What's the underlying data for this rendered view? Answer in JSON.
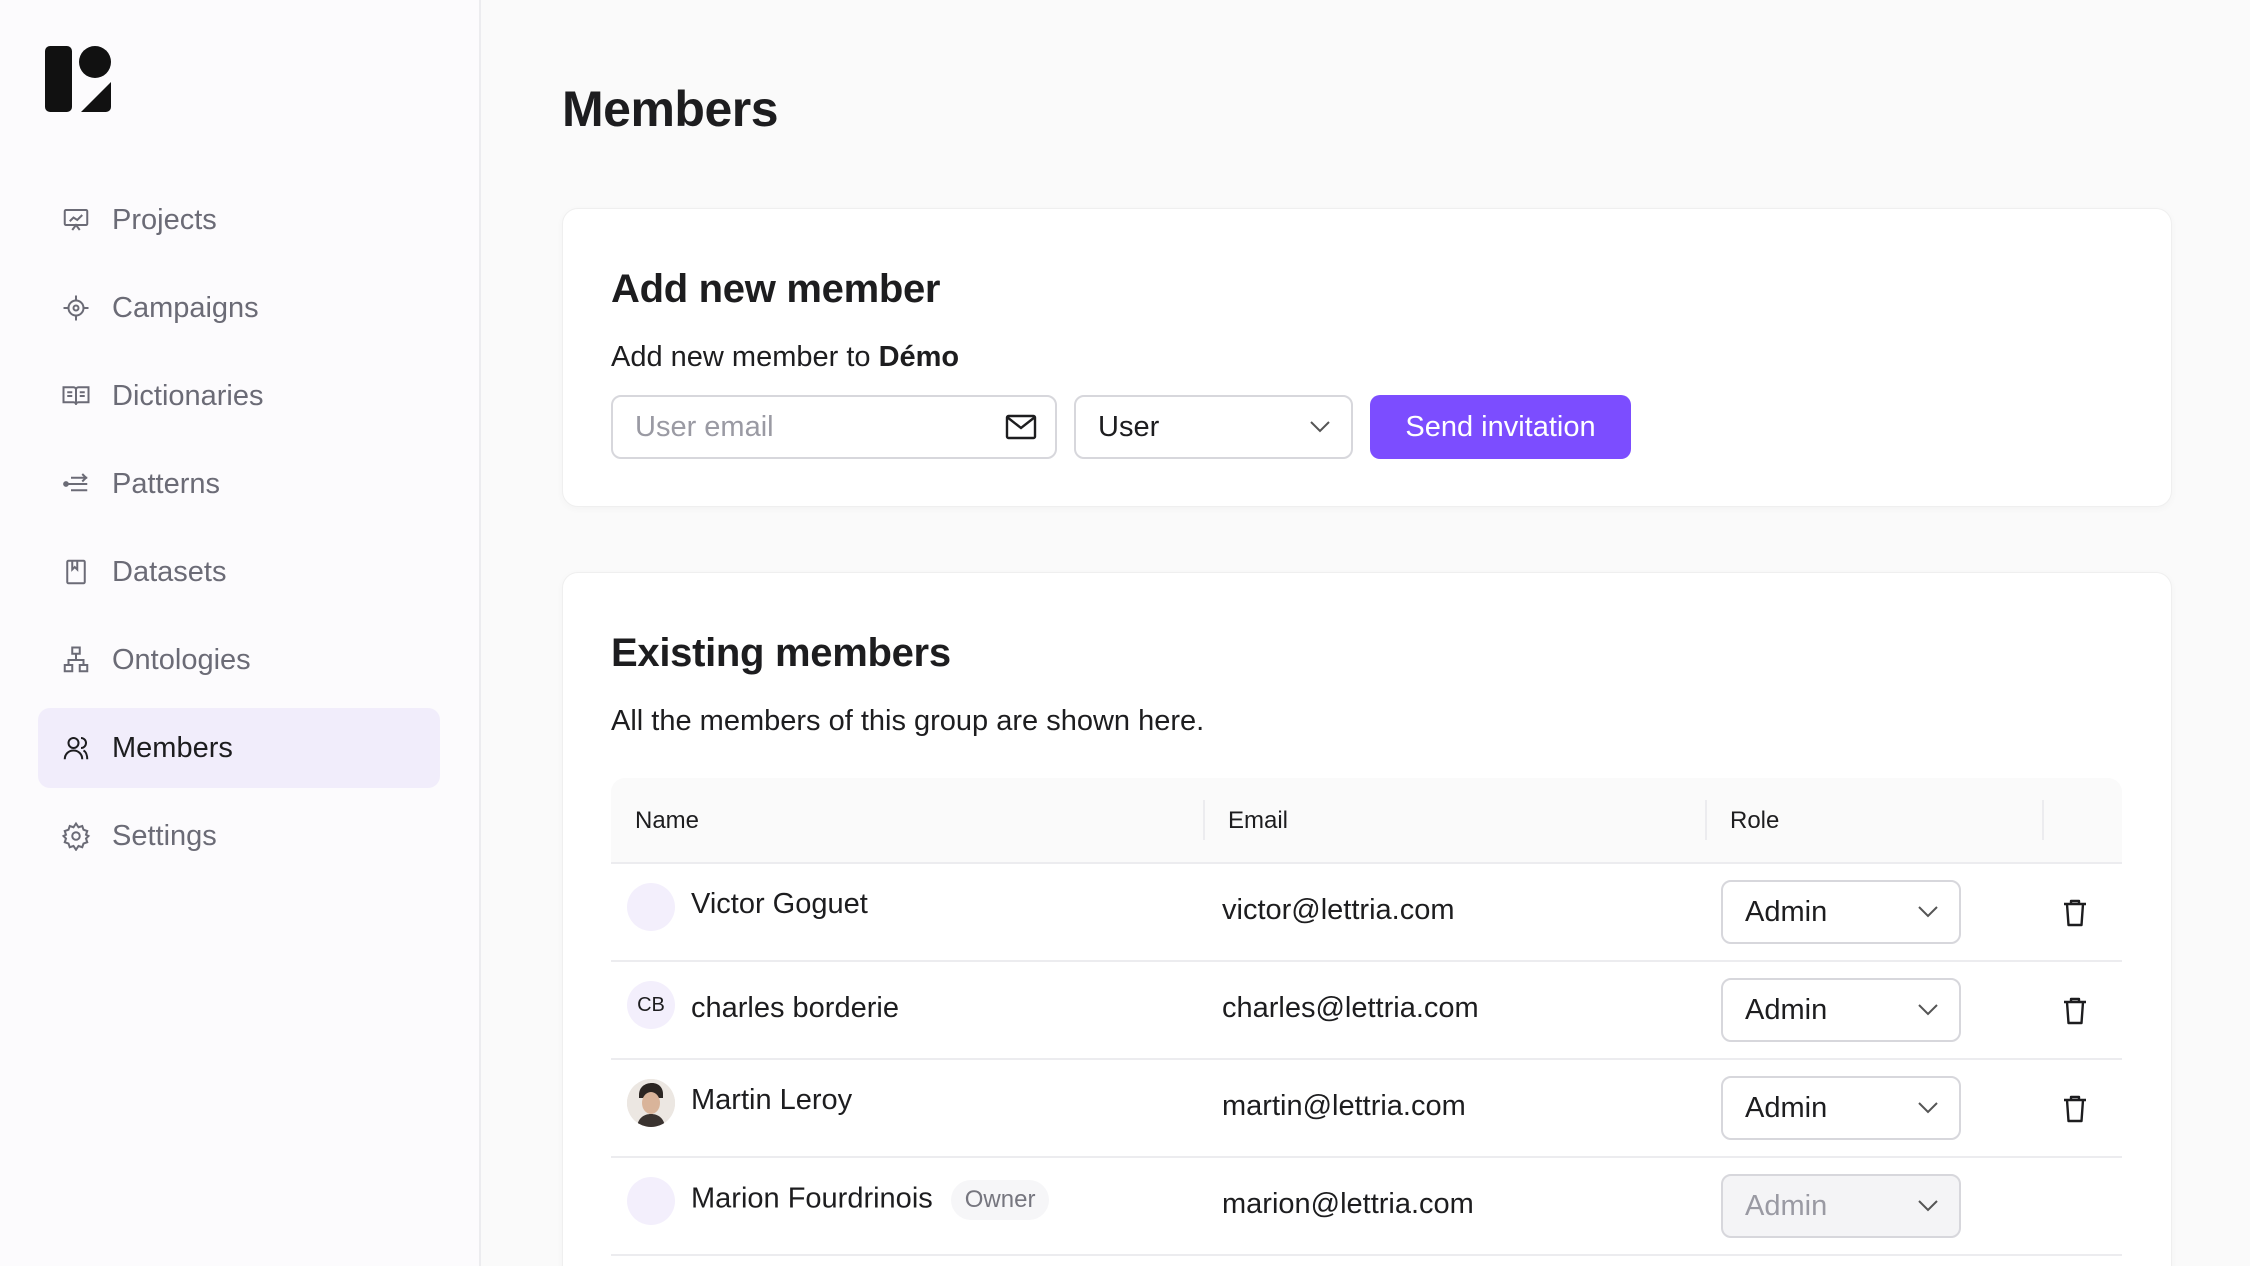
{
  "sidebar": {
    "items": [
      {
        "label": "Projects",
        "icon": "presentation-chart-icon"
      },
      {
        "label": "Campaigns",
        "icon": "target-icon"
      },
      {
        "label": "Dictionaries",
        "icon": "book-icon"
      },
      {
        "label": "Patterns",
        "icon": "patterns-icon"
      },
      {
        "label": "Datasets",
        "icon": "bookmark-icon"
      },
      {
        "label": "Ontologies",
        "icon": "hierarchy-icon"
      },
      {
        "label": "Members",
        "icon": "users-icon",
        "active": true
      },
      {
        "label": "Settings",
        "icon": "gear-icon"
      }
    ]
  },
  "main": {
    "title": "Members",
    "add_member": {
      "heading": "Add new member",
      "subtitle_prefix": "Add new member to ",
      "group_name": "Démo",
      "email_placeholder": "User email",
      "role_value": "User",
      "send_label": "Send invitation"
    },
    "existing": {
      "heading": "Existing members",
      "subtitle": "All the members of this group are shown here.",
      "columns": {
        "name": "Name",
        "email": "Email",
        "role": "Role"
      },
      "rows": [
        {
          "name": "Victor Goguet",
          "initials": "",
          "email": "victor@lettria.com",
          "role": "Admin",
          "owner": false
        },
        {
          "name": "charles borderie",
          "initials": "CB",
          "email": "charles@lettria.com",
          "role": "Admin",
          "owner": false
        },
        {
          "name": "Martin Leroy",
          "initials": "",
          "email": "martin@lettria.com",
          "role": "Admin",
          "owner": false
        },
        {
          "name": "Marion Fourdrinois",
          "initials": "",
          "email": "marion@lettria.com",
          "role": "Admin",
          "owner": true,
          "owner_label": "Owner"
        }
      ]
    }
  },
  "colors": {
    "accent": "#7c4dff",
    "active_nav_bg": "#f1edfb"
  }
}
